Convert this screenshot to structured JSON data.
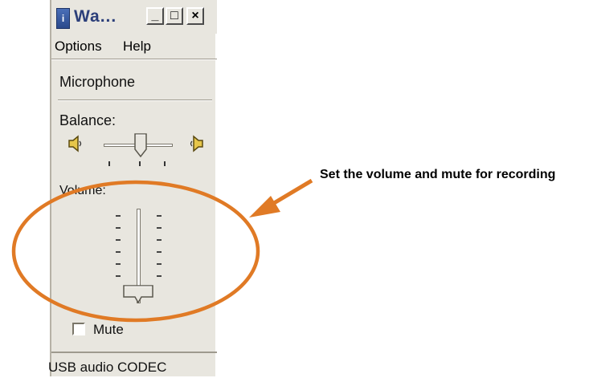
{
  "window": {
    "title": "Wa...",
    "minimize_glyph": "_",
    "maximize_glyph": "□",
    "close_glyph": "×"
  },
  "menu": {
    "items": [
      {
        "label": "Options"
      },
      {
        "label": "Help"
      }
    ]
  },
  "section": {
    "title": "Microphone"
  },
  "balance": {
    "label": "Balance:",
    "position": 0.5
  },
  "volume": {
    "label": "Volume:",
    "level": 0.05
  },
  "mute": {
    "label": "Mute",
    "checked": false
  },
  "status": {
    "text": "USB audio CODEC"
  },
  "annotation": {
    "text": "Set the volume and mute for recording",
    "color": "#e07a25"
  },
  "icons": [
    "app-icon",
    "speaker-left-icon",
    "speaker-right-icon"
  ],
  "colors": {
    "window_bg": "#e8e6df",
    "title_text": "#2c3f7a",
    "highlight_orange": "#e07a25"
  }
}
